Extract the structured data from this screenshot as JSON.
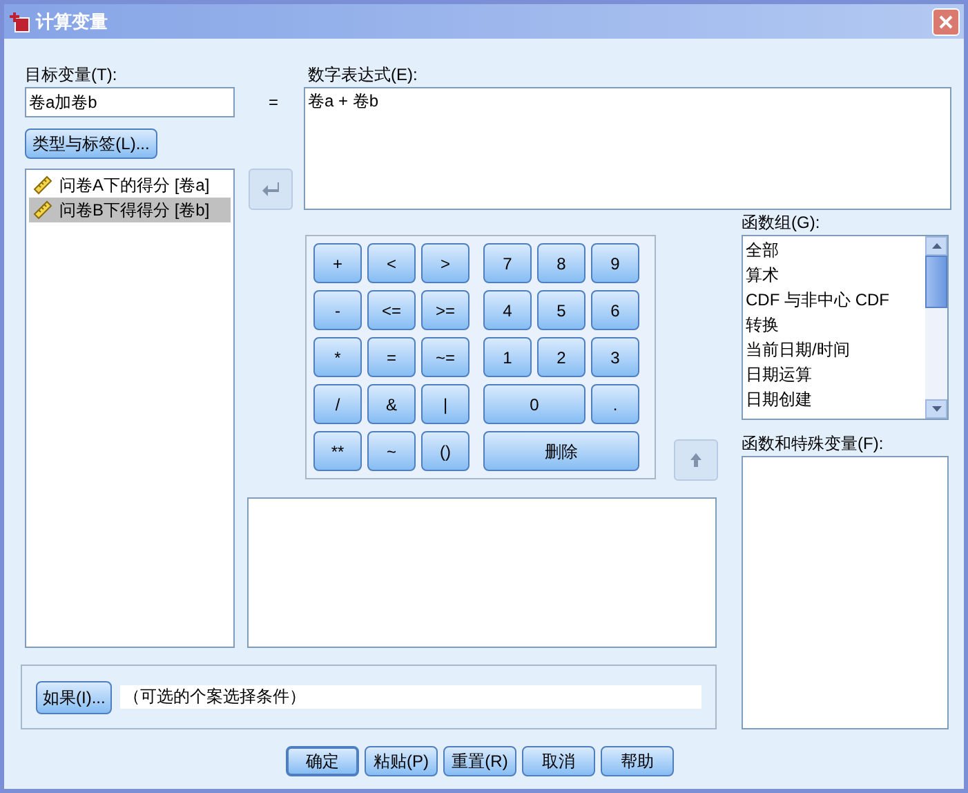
{
  "window": {
    "title": "计算变量"
  },
  "target": {
    "label": "目标变量(T):",
    "value": "卷a加卷b"
  },
  "equals": "=",
  "expression": {
    "label": "数字表达式(E):",
    "value": "卷a + 卷b"
  },
  "type_label_button": "类型与标签(L)...",
  "variables": [
    {
      "label": "问卷A下的得分 [卷a]",
      "selected": false
    },
    {
      "label": "问卷B下得得分 [卷b]",
      "selected": true
    }
  ],
  "operator_keys": [
    "+",
    "<",
    ">",
    "-",
    "<=",
    ">=",
    "*",
    "=",
    "~=",
    "/",
    "&",
    "|",
    "**",
    "~",
    "()"
  ],
  "number_keys": [
    {
      "label": "7",
      "kind": "single"
    },
    {
      "label": "8",
      "kind": "single"
    },
    {
      "label": "9",
      "kind": "single"
    },
    {
      "label": "4",
      "kind": "single"
    },
    {
      "label": "5",
      "kind": "single"
    },
    {
      "label": "6",
      "kind": "single"
    },
    {
      "label": "1",
      "kind": "single"
    },
    {
      "label": "2",
      "kind": "single"
    },
    {
      "label": "3",
      "kind": "single"
    },
    {
      "label": "0",
      "kind": "double"
    },
    {
      "label": ".",
      "kind": "single"
    },
    {
      "label": "删除",
      "kind": "triple"
    }
  ],
  "function_groups": {
    "label": "函数组(G):",
    "items": [
      {
        "label": "全部",
        "selected": false
      },
      {
        "label": "算术",
        "selected": false
      },
      {
        "label": "CDF 与非中心 CDF",
        "selected": false
      },
      {
        "label": "转换",
        "selected": false
      },
      {
        "label": "当前日期/时间",
        "selected": false
      },
      {
        "label": "日期运算",
        "selected": false
      },
      {
        "label": "日期创建",
        "selected": false
      }
    ]
  },
  "functions": {
    "label": "函数和特殊变量(F):"
  },
  "condition": {
    "button": "如果(I)...",
    "text": "（可选的个案选择条件）"
  },
  "buttons": [
    {
      "label": "确定",
      "default": true
    },
    {
      "label": "粘贴(P)",
      "default": false
    },
    {
      "label": "重置(R)",
      "default": false
    },
    {
      "label": "取消",
      "default": false
    },
    {
      "label": "帮助",
      "default": false
    }
  ]
}
